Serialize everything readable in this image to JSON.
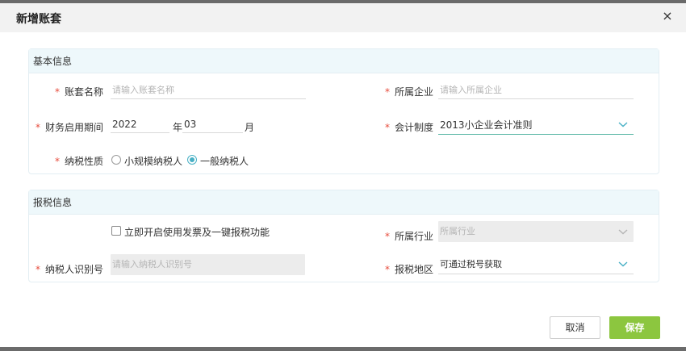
{
  "dialog": {
    "title": "新增账套",
    "close_symbol": "×"
  },
  "basic": {
    "section_title": "基本信息",
    "account_name": {
      "label": "账套名称",
      "placeholder": "请输入账套名称"
    },
    "company": {
      "label": "所属企业",
      "placeholder": "请输入所属企业"
    },
    "period": {
      "label": "财务启用期间",
      "year": "2022",
      "year_unit": "年",
      "month": "03",
      "month_unit": "月"
    },
    "accounting_system": {
      "label": "会计制度",
      "value": "2013小企业会计准则"
    },
    "taxpayer": {
      "label": "纳税性质",
      "options": [
        {
          "label": "小规模纳税人",
          "selected": false
        },
        {
          "label": "一般纳税人",
          "selected": true
        }
      ]
    }
  },
  "tax": {
    "section_title": "报税信息",
    "enable_invoice": {
      "label": "立即开启使用发票及一键报税功能",
      "checked": false
    },
    "industry": {
      "label": "所属行业",
      "placeholder": "所属行业"
    },
    "taxpayer_id": {
      "label": "纳税人识别号",
      "placeholder": "请输入纳税人识别号"
    },
    "region": {
      "label": "报税地区",
      "placeholder": "可通过税号获取"
    }
  },
  "footer": {
    "cancel_label": "取消",
    "save_label": "保存"
  },
  "colors": {
    "required": "#e74c3c",
    "accent": "#48b0c5",
    "save_button": "#8cc63f",
    "section_header_bg": "#eef8fb"
  }
}
